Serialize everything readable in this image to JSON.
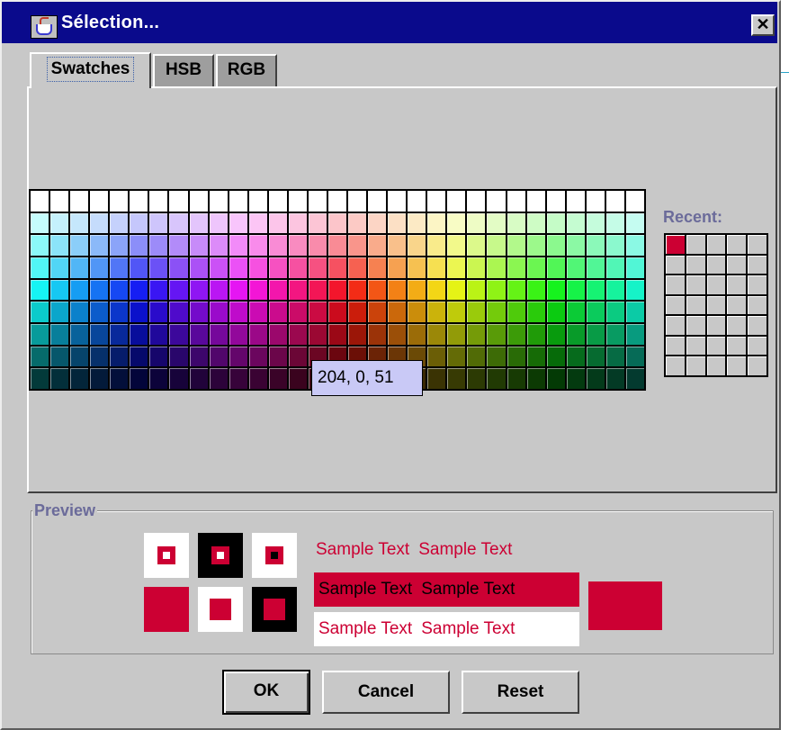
{
  "window": {
    "title": "Sélection..."
  },
  "tabs": [
    {
      "label": "Swatches",
      "active": true
    },
    {
      "label": "HSB",
      "active": false
    },
    {
      "label": "RGB",
      "active": false
    }
  ],
  "swatches": {
    "columns": 31,
    "rows": 9
  },
  "recent": {
    "label": "Recent:",
    "columns": 5,
    "rows": 7,
    "first_color": "#cc0033"
  },
  "tooltip": {
    "text": "204, 0, 51"
  },
  "preview": {
    "label": "Preview",
    "selected_color": "#cc0033",
    "sample_text_1": "Sample Text",
    "sample_text_2": "Sample Text"
  },
  "buttons": {
    "ok": "OK",
    "cancel": "Cancel",
    "reset": "Reset"
  },
  "colors": {
    "titlebar": "#0a0a8c",
    "panel": "#c8c8c8",
    "selected": "#cc0033",
    "tooltip_bg": "#c9c9f6",
    "label_color": "#6b6b9a"
  }
}
